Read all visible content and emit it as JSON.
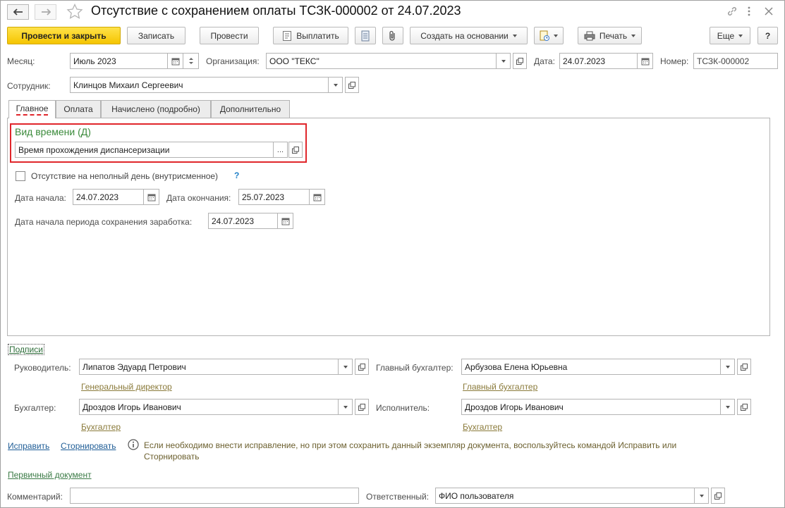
{
  "window": {
    "title": "Отсутствие с сохранением оплаты ТСЗК-000002 от 24.07.2023"
  },
  "toolbar": {
    "post_and_close": "Провести и закрыть",
    "save": "Записать",
    "post": "Провести",
    "pay": "Выплатить",
    "create_based_on": "Создать на основании",
    "print": "Печать",
    "more": "Еще",
    "help": "?"
  },
  "header": {
    "month_label": "Месяц:",
    "month_value": "Июль 2023",
    "org_label": "Организация:",
    "org_value": "ООО \"ТЕКС\"",
    "date_label": "Дата:",
    "date_value": "24.07.2023",
    "number_label": "Номер:",
    "number_value": "ТСЗК-000002",
    "employee_label": "Сотрудник:",
    "employee_value": "Клинцов Михаил Сергеевич"
  },
  "tabs": [
    "Главное",
    "Оплата",
    "Начислено (подробно)",
    "Дополнительно"
  ],
  "main": {
    "time_type_label": "Вид времени (Д)",
    "time_type_value": "Время прохождения диспансеризации",
    "partial_day_label": "Отсутствие на неполный день (внутрисменное)",
    "partial_day_checked": false,
    "help_mark": "?",
    "start_label": "Дата начала:",
    "start_value": "24.07.2023",
    "end_label": "Дата окончания:",
    "end_value": "25.07.2023",
    "period_start_label": "Дата начала периода сохранения заработка:",
    "period_start_value": "24.07.2023",
    "more_button": "..."
  },
  "signatures": {
    "section_link": "Подписи",
    "head_label": "Руководитель:",
    "head_value": "Липатов Эдуард Петрович",
    "head_position": "Генеральный директор",
    "chief_acc_label": "Главный бухгалтер:",
    "chief_acc_value": "Арбузова Елена Юрьевна",
    "chief_acc_position": "Главный бухгалтер",
    "accountant_label": "Бухгалтер:",
    "accountant_value": "Дроздов Игорь Иванович",
    "accountant_position": "Бухгалтер",
    "executor_label": "Исполнитель:",
    "executor_value": "Дроздов Игорь Иванович",
    "executor_position": "Бухгалтер"
  },
  "correction": {
    "fix_link": "Исправить",
    "reverse_link": "Сторнировать",
    "info_line1": "Если необходимо внести исправление, но при этом сохранить данный экземпляр документа, воспользуйтесь командой Исправить или",
    "info_line2": "Сторнировать"
  },
  "footer": {
    "primary_doc_link": "Первичный документ",
    "comment_label": "Комментарий:",
    "comment_value": "",
    "responsible_label": "Ответственный:",
    "responsible_value": "ФИО пользователя"
  },
  "colors": {
    "accent_yellow": "#f5c500",
    "highlight_red": "#e0262b",
    "green_label": "#3a8a3a",
    "link_blue": "#1f5d96"
  }
}
